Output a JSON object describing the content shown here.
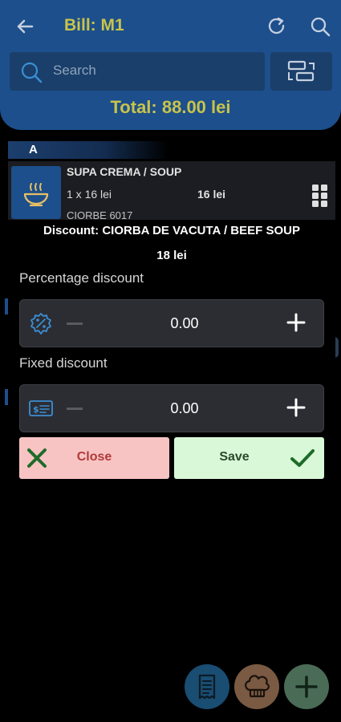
{
  "header": {
    "title": "Bill: M1",
    "search_placeholder": "Search",
    "total": "Total: 88.00 lei"
  },
  "list": {
    "section": "A",
    "item": {
      "name": "SUPA CREMA  / SOUP",
      "qty": "1 x  16 lei",
      "total": "16 lei",
      "code": "CIORBE 6017"
    }
  },
  "dialog": {
    "title": "Discount: CIORBA DE VACUTA / BEEF SOUP",
    "price": "18 lei",
    "percentage_label": "Percentage discount",
    "percentage_value": "0.00",
    "fixed_label": "Fixed discount",
    "fixed_value": "0.00",
    "close_label": "Close",
    "save_label": "Save"
  },
  "colors": {
    "header_bg": "#1c4f8c",
    "title_accent": "#c9c34a",
    "close_bg": "#f7c4c3",
    "save_bg": "#d9f8d8"
  },
  "icons": {
    "back": "arrow-left-icon",
    "refresh": "refresh-icon",
    "search": "search-icon",
    "layout": "layout-switch-icon",
    "soup": "soup-bowl-icon",
    "menu": "grid-menu-icon",
    "percent": "percent-badge-icon",
    "money": "money-card-icon",
    "close": "x-icon",
    "save": "check-icon",
    "bill": "receipt-icon",
    "kitchen": "chef-hat-icon",
    "add": "plus-icon"
  }
}
